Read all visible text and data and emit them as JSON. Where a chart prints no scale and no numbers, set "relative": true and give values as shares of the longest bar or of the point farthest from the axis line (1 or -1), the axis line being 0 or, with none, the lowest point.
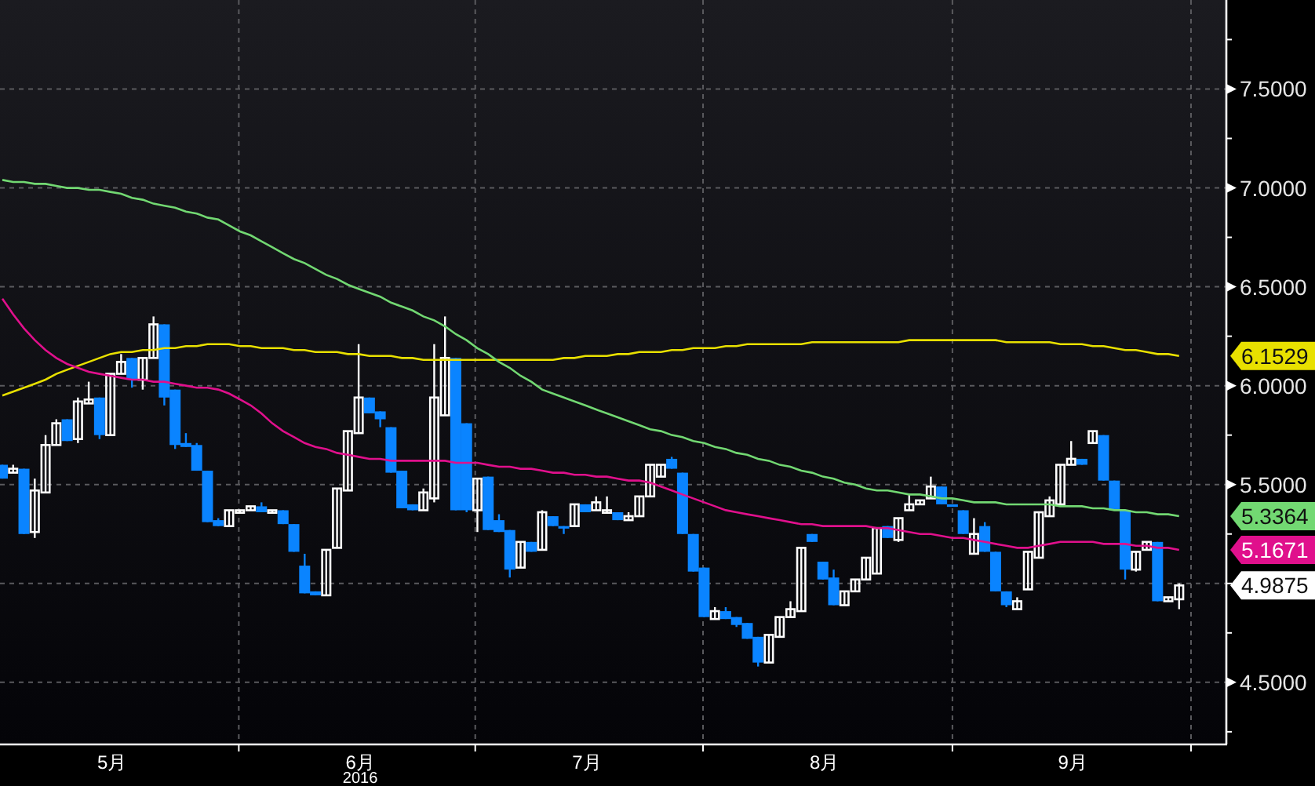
{
  "chart": {
    "chart_data": {
      "type": "candlestick",
      "xlabel": "2016",
      "grid": true,
      "categories": [
        null,
        null,
        null,
        null,
        null,
        null,
        null,
        null,
        null,
        null,
        "5月",
        null,
        null,
        null,
        null,
        null,
        null,
        null,
        null,
        null,
        null,
        null,
        null,
        null,
        null,
        null,
        null,
        null,
        null,
        null,
        null,
        null,
        null,
        "6月",
        null,
        null,
        null,
        null,
        null,
        null,
        null,
        null,
        null,
        null,
        null,
        null,
        null,
        null,
        null,
        null,
        null,
        null,
        null,
        null,
        "7月",
        null,
        null,
        null,
        null,
        null,
        null,
        null,
        null,
        null,
        null,
        null,
        null,
        null,
        null,
        null,
        null,
        null,
        null,
        null,
        null,
        null,
        "8月",
        null,
        null,
        null,
        null,
        null,
        null,
        null,
        null,
        null,
        null,
        null,
        null,
        null,
        null,
        null,
        null,
        null,
        null,
        null,
        null,
        null,
        null,
        "9月",
        null,
        null,
        null,
        null,
        null,
        null,
        null,
        null,
        null,
        null
      ],
      "ylim": [
        4.19,
        7.95
      ],
      "yticks": [
        {
          "value": 4.5,
          "label": "4.5000"
        },
        {
          "value": 5.5,
          "label": "5.5000"
        },
        {
          "value": 6.0,
          "label": "6.0000"
        },
        {
          "value": 6.5,
          "label": "6.5000"
        },
        {
          "value": 7.0,
          "label": "7.0000"
        },
        {
          "value": 7.5,
          "label": "7.5000"
        }
      ],
      "ohlc": [
        [
          5.6,
          5.6,
          5.53,
          5.53
        ],
        [
          5.56,
          5.6,
          5.56,
          5.58
        ],
        [
          5.58,
          5.58,
          5.25,
          5.25
        ],
        [
          5.26,
          5.53,
          5.23,
          5.47
        ],
        [
          5.46,
          5.75,
          5.46,
          5.7
        ],
        [
          5.7,
          5.83,
          5.7,
          5.81
        ],
        [
          5.83,
          5.83,
          5.72,
          5.72
        ],
        [
          5.73,
          5.94,
          5.71,
          5.92
        ],
        [
          5.91,
          6.02,
          5.91,
          5.93
        ],
        [
          5.94,
          5.94,
          5.73,
          5.75
        ],
        [
          5.75,
          6.06,
          5.75,
          6.06
        ],
        [
          6.06,
          6.16,
          6.06,
          6.12
        ],
        [
          6.14,
          6.14,
          5.99,
          6.03
        ],
        [
          6.03,
          6.14,
          5.98,
          6.14
        ],
        [
          6.14,
          6.35,
          6.14,
          6.31
        ],
        [
          6.31,
          6.31,
          5.9,
          5.94
        ],
        [
          5.98,
          5.98,
          5.68,
          5.7
        ],
        [
          5.71,
          5.76,
          5.69,
          5.69
        ],
        [
          5.7,
          5.71,
          5.57,
          5.57
        ],
        [
          5.57,
          5.57,
          5.31,
          5.31
        ],
        [
          5.32,
          5.33,
          5.29,
          5.29
        ],
        [
          5.29,
          5.37,
          5.29,
          5.37
        ],
        [
          5.36,
          5.37,
          5.36,
          5.37
        ],
        [
          5.37,
          5.39,
          5.37,
          5.39
        ],
        [
          5.39,
          5.41,
          5.36,
          5.36
        ],
        [
          5.36,
          5.37,
          5.36,
          5.37
        ],
        [
          5.37,
          5.37,
          5.3,
          5.3
        ],
        [
          5.3,
          5.3,
          5.16,
          5.16
        ],
        [
          5.09,
          5.15,
          4.95,
          4.95
        ],
        [
          4.96,
          4.96,
          4.94,
          4.94
        ],
        [
          4.94,
          5.17,
          4.94,
          5.17
        ],
        [
          5.18,
          5.48,
          5.18,
          5.48
        ],
        [
          5.47,
          5.77,
          5.47,
          5.77
        ],
        [
          5.76,
          6.21,
          5.76,
          5.94
        ],
        [
          5.94,
          5.94,
          5.86,
          5.86
        ],
        [
          5.87,
          5.87,
          5.79,
          5.83
        ],
        [
          5.79,
          5.79,
          5.56,
          5.56
        ],
        [
          5.57,
          5.57,
          5.38,
          5.38
        ],
        [
          5.4,
          5.4,
          5.37,
          5.37
        ],
        [
          5.37,
          5.48,
          5.37,
          5.46
        ],
        [
          5.43,
          6.21,
          5.41,
          5.94
        ],
        [
          5.85,
          6.35,
          5.85,
          6.14
        ],
        [
          6.14,
          6.14,
          5.37,
          5.37
        ],
        [
          5.81,
          5.81,
          5.36,
          5.37
        ],
        [
          5.37,
          5.53,
          5.26,
          5.53
        ],
        [
          5.54,
          5.54,
          5.27,
          5.27
        ],
        [
          5.32,
          5.35,
          5.26,
          5.26
        ],
        [
          5.27,
          5.27,
          5.03,
          5.07
        ],
        [
          5.08,
          5.21,
          5.08,
          5.21
        ],
        [
          5.21,
          5.21,
          5.16,
          5.16
        ],
        [
          5.17,
          5.37,
          5.17,
          5.36
        ],
        [
          5.34,
          5.34,
          5.29,
          5.29
        ],
        [
          5.29,
          5.29,
          5.25,
          5.28
        ],
        [
          5.29,
          5.4,
          5.29,
          5.4
        ],
        [
          5.4,
          5.4,
          5.36,
          5.36
        ],
        [
          5.37,
          5.44,
          5.37,
          5.41
        ],
        [
          5.36,
          5.44,
          5.36,
          5.37
        ],
        [
          5.36,
          5.36,
          5.32,
          5.32
        ],
        [
          5.32,
          5.36,
          5.32,
          5.34
        ],
        [
          5.34,
          5.44,
          5.34,
          5.44
        ],
        [
          5.44,
          5.6,
          5.44,
          5.6
        ],
        [
          5.54,
          5.6,
          5.54,
          5.6
        ],
        [
          5.63,
          5.64,
          5.58,
          5.58
        ],
        [
          5.56,
          5.56,
          5.25,
          5.25
        ],
        [
          5.25,
          5.25,
          5.06,
          5.06
        ],
        [
          5.08,
          5.08,
          4.83,
          4.83
        ],
        [
          4.82,
          4.88,
          4.82,
          4.86
        ],
        [
          4.86,
          4.88,
          4.82,
          4.82
        ],
        [
          4.83,
          4.83,
          4.78,
          4.79
        ],
        [
          4.8,
          4.8,
          4.72,
          4.72
        ],
        [
          4.73,
          4.73,
          4.58,
          4.6
        ],
        [
          4.6,
          4.74,
          4.6,
          4.74
        ],
        [
          4.73,
          4.83,
          4.73,
          4.83
        ],
        [
          4.83,
          4.91,
          4.83,
          4.87
        ],
        [
          4.86,
          5.18,
          4.86,
          5.18
        ],
        [
          5.25,
          5.25,
          5.21,
          5.21
        ],
        [
          5.11,
          5.11,
          5.02,
          5.02
        ],
        [
          5.03,
          5.07,
          4.89,
          4.89
        ],
        [
          4.89,
          4.96,
          4.89,
          4.96
        ],
        [
          4.96,
          5.02,
          4.96,
          5.02
        ],
        [
          5.02,
          5.13,
          5.02,
          5.13
        ],
        [
          5.05,
          5.28,
          5.05,
          5.28
        ],
        [
          5.29,
          5.29,
          5.23,
          5.23
        ],
        [
          5.22,
          5.33,
          5.21,
          5.33
        ],
        [
          5.37,
          5.45,
          5.37,
          5.4
        ],
        [
          5.4,
          5.42,
          5.4,
          5.42
        ],
        [
          5.43,
          5.54,
          5.43,
          5.49
        ],
        [
          5.49,
          5.49,
          5.4,
          5.4
        ],
        [
          5.4,
          5.4,
          5.39,
          5.39
        ],
        [
          5.37,
          5.37,
          5.25,
          5.25
        ],
        [
          5.15,
          5.33,
          5.15,
          5.25
        ],
        [
          5.29,
          5.31,
          5.16,
          5.16
        ],
        [
          5.16,
          5.16,
          4.96,
          4.96
        ],
        [
          4.96,
          4.96,
          4.88,
          4.89
        ],
        [
          4.87,
          4.93,
          4.87,
          4.91
        ],
        [
          4.97,
          5.16,
          4.97,
          5.16
        ],
        [
          5.13,
          5.36,
          5.13,
          5.36
        ],
        [
          5.34,
          5.44,
          5.34,
          5.42
        ],
        [
          5.4,
          5.6,
          5.4,
          5.6
        ],
        [
          5.6,
          5.72,
          5.6,
          5.63
        ],
        [
          5.63,
          5.63,
          5.6,
          5.6
        ],
        [
          5.71,
          5.77,
          5.71,
          5.77
        ],
        [
          5.75,
          5.75,
          5.52,
          5.52
        ],
        [
          5.52,
          5.52,
          5.37,
          5.37
        ],
        [
          5.37,
          5.37,
          5.02,
          5.07
        ],
        [
          5.07,
          5.16,
          5.06,
          5.16
        ],
        [
          5.17,
          5.21,
          5.17,
          5.21
        ],
        [
          5.21,
          5.21,
          4.91,
          4.91
        ],
        [
          4.91,
          4.93,
          4.91,
          4.93
        ],
        [
          4.92,
          5.0,
          4.87,
          4.99
        ]
      ],
      "annotations": [
        "6.1529",
        "5.3364",
        "5.1671",
        "4.9875"
      ]
    }
  },
  "moving_averages": {
    "chart_data": {
      "type": "line",
      "relative": true,
      "ylim": [
        4.19,
        7.95
      ],
      "series": [
        {
          "color": "#e8e000",
          "values": [
            5.95,
            5.97,
            5.99,
            6.01,
            6.03,
            6.06,
            6.08,
            6.1,
            6.12,
            6.14,
            6.16,
            6.17,
            6.17,
            6.18,
            6.18,
            6.19,
            6.19,
            6.2,
            6.2,
            6.21,
            6.21,
            6.21,
            6.2,
            6.2,
            6.19,
            6.19,
            6.19,
            6.18,
            6.18,
            6.17,
            6.17,
            6.17,
            6.16,
            6.16,
            6.15,
            6.15,
            6.15,
            6.14,
            6.14,
            6.13,
            6.13,
            6.13,
            6.13,
            6.13,
            6.13,
            6.13,
            6.13,
            6.13,
            6.13,
            6.13,
            6.13,
            6.13,
            6.14,
            6.14,
            6.15,
            6.15,
            6.15,
            6.16,
            6.16,
            6.17,
            6.17,
            6.17,
            6.18,
            6.18,
            6.19,
            6.19,
            6.19,
            6.2,
            6.2,
            6.21,
            6.21,
            6.21,
            6.21,
            6.21,
            6.21,
            6.22,
            6.22,
            6.22,
            6.22,
            6.22,
            6.22,
            6.22,
            6.22,
            6.22,
            6.23,
            6.23,
            6.23,
            6.23,
            6.23,
            6.23,
            6.23,
            6.23,
            6.23,
            6.22,
            6.22,
            6.22,
            6.22,
            6.22,
            6.21,
            6.21,
            6.21,
            6.2,
            6.2,
            6.19,
            6.18,
            6.18,
            6.17,
            6.16,
            6.16,
            6.15
          ]
        },
        {
          "color": "#72d872",
          "values": [
            7.04,
            7.03,
            7.03,
            7.02,
            7.02,
            7.01,
            7.0,
            7.0,
            6.99,
            6.99,
            6.98,
            6.97,
            6.95,
            6.94,
            6.92,
            6.91,
            6.9,
            6.88,
            6.87,
            6.85,
            6.84,
            6.81,
            6.78,
            6.76,
            6.73,
            6.7,
            6.67,
            6.64,
            6.62,
            6.59,
            6.56,
            6.54,
            6.51,
            6.49,
            6.47,
            6.45,
            6.42,
            6.4,
            6.38,
            6.35,
            6.33,
            6.3,
            6.26,
            6.23,
            6.19,
            6.16,
            6.12,
            6.09,
            6.05,
            6.02,
            5.98,
            5.96,
            5.94,
            5.92,
            5.9,
            5.88,
            5.86,
            5.84,
            5.82,
            5.8,
            5.78,
            5.77,
            5.75,
            5.74,
            5.72,
            5.71,
            5.69,
            5.68,
            5.66,
            5.65,
            5.63,
            5.62,
            5.6,
            5.59,
            5.57,
            5.56,
            5.54,
            5.53,
            5.51,
            5.5,
            5.48,
            5.47,
            5.47,
            5.46,
            5.45,
            5.45,
            5.44,
            5.43,
            5.43,
            5.42,
            5.41,
            5.41,
            5.41,
            5.4,
            5.4,
            5.4,
            5.4,
            5.4,
            5.39,
            5.39,
            5.39,
            5.38,
            5.38,
            5.37,
            5.37,
            5.36,
            5.36,
            5.35,
            5.35,
            5.34
          ]
        },
        {
          "color": "#e0108c",
          "values": [
            6.44,
            6.36,
            6.29,
            6.23,
            6.18,
            6.14,
            6.11,
            6.09,
            6.07,
            6.06,
            6.05,
            6.04,
            6.03,
            6.03,
            6.02,
            6.02,
            6.01,
            6.0,
            5.99,
            5.99,
            5.98,
            5.96,
            5.93,
            5.9,
            5.86,
            5.81,
            5.77,
            5.74,
            5.71,
            5.69,
            5.68,
            5.66,
            5.65,
            5.64,
            5.63,
            5.63,
            5.62,
            5.62,
            5.62,
            5.62,
            5.62,
            5.62,
            5.61,
            5.61,
            5.61,
            5.6,
            5.59,
            5.59,
            5.58,
            5.58,
            5.57,
            5.56,
            5.56,
            5.55,
            5.55,
            5.54,
            5.54,
            5.53,
            5.52,
            5.52,
            5.51,
            5.49,
            5.47,
            5.45,
            5.43,
            5.41,
            5.39,
            5.37,
            5.36,
            5.35,
            5.34,
            5.33,
            5.32,
            5.31,
            5.3,
            5.3,
            5.29,
            5.29,
            5.29,
            5.29,
            5.29,
            5.28,
            5.28,
            5.27,
            5.26,
            5.25,
            5.25,
            5.24,
            5.23,
            5.23,
            5.22,
            5.21,
            5.2,
            5.19,
            5.18,
            5.18,
            5.19,
            5.2,
            5.21,
            5.21,
            5.21,
            5.21,
            5.2,
            5.2,
            5.2,
            5.19,
            5.19,
            5.18,
            5.18,
            5.17
          ]
        }
      ]
    }
  }
}
